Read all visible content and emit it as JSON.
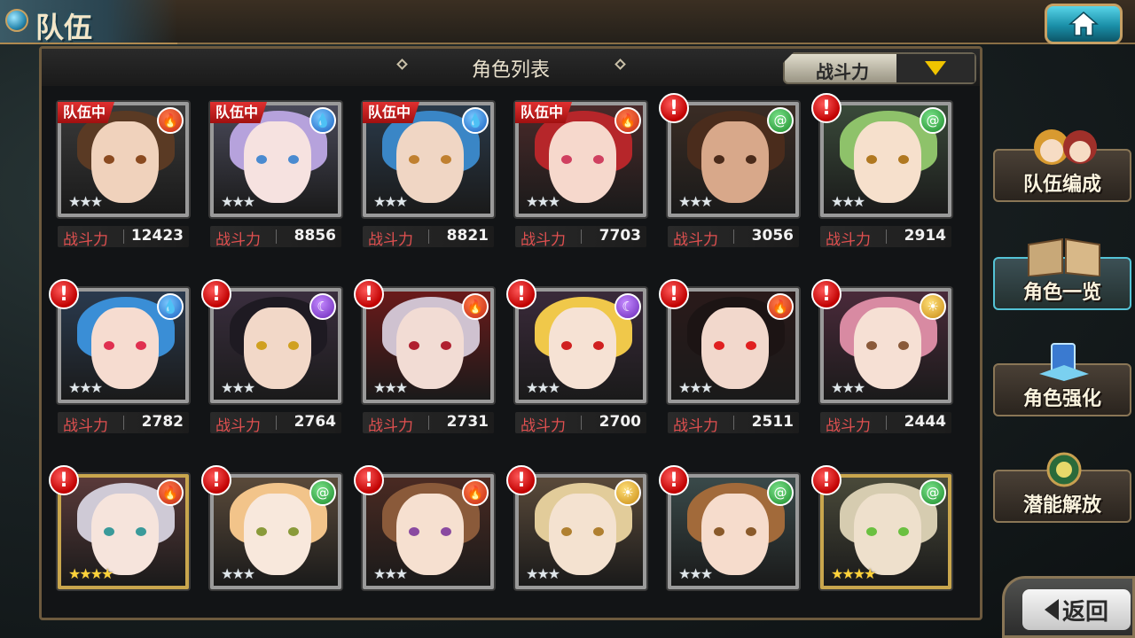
{
  "header": {
    "title": "队伍",
    "home_icon": "home-icon"
  },
  "panel": {
    "title": "角色列表",
    "sort_label": "战斗力",
    "power_label": "战斗力"
  },
  "side_menu": [
    {
      "label": "队伍编成",
      "active": false
    },
    {
      "label": "角色一览",
      "active": true
    },
    {
      "label": "角色强化",
      "active": false
    },
    {
      "label": "潜能解放",
      "active": false
    }
  ],
  "back_label": "返回",
  "colors": {
    "fire": "#d83a1a",
    "water": "#2a78d8",
    "wind": "#2aa23a",
    "dark": "#8a3ad8",
    "light": "#e0a020",
    "alert": "#d40000",
    "team_badge": "#c81e1e"
  },
  "team_badge_label": "队伍中",
  "characters": [
    {
      "badge": "队伍中",
      "element": "fire",
      "stars": "★★★",
      "gold": false,
      "power": "12423",
      "hair": "#5a3a24",
      "skin": "#f0d2bc",
      "bg": "#3a3a3a",
      "eye": "#8a4a20"
    },
    {
      "badge": "队伍中",
      "element": "water",
      "stars": "★★★",
      "gold": false,
      "power": "8856",
      "hair": "#b6a2dc",
      "skin": "#f6e2e0",
      "bg": "#4a4a5a",
      "eye": "#4a8ad0"
    },
    {
      "badge": "队伍中",
      "element": "water",
      "stars": "★★★",
      "gold": false,
      "power": "8821",
      "hair": "#3a86c6",
      "skin": "#f0d6c4",
      "bg": "#2a3a4a",
      "eye": "#c08030"
    },
    {
      "badge": "队伍中",
      "element": "fire",
      "stars": "★★★",
      "gold": false,
      "power": "7703",
      "hair": "#b6262a",
      "skin": "#f6d8cc",
      "bg": "#4a2a2a",
      "eye": "#d04060"
    },
    {
      "badge": "",
      "alert": "!",
      "element": "wind",
      "stars": "★★★",
      "gold": false,
      "power": "3056",
      "hair": "#4a2c1c",
      "skin": "#d8a88a",
      "bg": "#3a2c24",
      "eye": "#4a2a1a"
    },
    {
      "badge": "",
      "alert": "!",
      "element": "wind",
      "stars": "★★★",
      "gold": false,
      "power": "2914",
      "hair": "#8ec26a",
      "skin": "#f6e0cc",
      "bg": "#3a4a3a",
      "eye": "#b07820"
    },
    {
      "badge": "",
      "alert": "!",
      "element": "water",
      "stars": "★★★",
      "gold": false,
      "power": "2782",
      "hair": "#3a8ed6",
      "skin": "#f6dcd0",
      "bg": "#2a3a4e",
      "eye": "#e03050"
    },
    {
      "badge": "",
      "alert": "!",
      "element": "dark",
      "stars": "★★★",
      "gold": false,
      "power": "2764",
      "hair": "#1e1a22",
      "skin": "#f2d8c8",
      "bg": "#3a2e3e",
      "eye": "#d0a020"
    },
    {
      "badge": "",
      "alert": "!",
      "element": "fire",
      "stars": "★★★",
      "gold": false,
      "power": "2731",
      "hair": "#cfc2d0",
      "skin": "#f2dcd4",
      "bg": "#6a1a1a",
      "eye": "#b02030"
    },
    {
      "badge": "",
      "alert": "!",
      "element": "dark",
      "stars": "★★★",
      "gold": false,
      "power": "2700",
      "hair": "#f0c84a",
      "skin": "#f6e2d4",
      "bg": "#3a2a3a",
      "eye": "#d02020"
    },
    {
      "badge": "",
      "alert": "!",
      "element": "fire",
      "stars": "★★★",
      "gold": false,
      "power": "2511",
      "hair": "#1c1414",
      "skin": "#f2d8cc",
      "bg": "#2a1a1a",
      "eye": "#e02020"
    },
    {
      "badge": "",
      "alert": "!",
      "element": "light",
      "stars": "★★★",
      "gold": false,
      "power": "2444",
      "hair": "#d88aa2",
      "skin": "#f6e0d4",
      "bg": "#4a2a3a",
      "eye": "#8a5a3a"
    },
    {
      "badge": "",
      "alert": "!",
      "element": "fire",
      "stars": "★★★★",
      "gold": true,
      "power": "",
      "hair": "#cfcad6",
      "skin": "#f6e4dc",
      "bg": "#5a3a3a",
      "eye": "#3a9a9a"
    },
    {
      "badge": "",
      "alert": "!",
      "element": "wind",
      "stars": "★★★",
      "gold": false,
      "power": "",
      "hair": "#f2c48a",
      "skin": "#f8e8dc",
      "bg": "#5a4a3a",
      "eye": "#8a9a3a"
    },
    {
      "badge": "",
      "alert": "!",
      "element": "fire",
      "stars": "★★★",
      "gold": false,
      "power": "",
      "hair": "#8a5a3a",
      "skin": "#f6e0d0",
      "bg": "#4a2a22",
      "eye": "#8a4aa0"
    },
    {
      "badge": "",
      "alert": "!",
      "element": "light",
      "stars": "★★★",
      "gold": false,
      "power": "",
      "hair": "#e2cc9a",
      "skin": "#f4e2d0",
      "bg": "#5a4a3a",
      "eye": "#b08030"
    },
    {
      "badge": "",
      "alert": "!",
      "element": "wind",
      "stars": "★★★",
      "gold": false,
      "power": "",
      "hair": "#a26a3a",
      "skin": "#f6dccc",
      "bg": "#3a4a4a",
      "eye": "#8a5a2a"
    },
    {
      "badge": "",
      "alert": "!",
      "element": "wind",
      "stars": "★★★★",
      "gold": true,
      "power": "",
      "hair": "#d6ccb0",
      "skin": "#eee0cc",
      "bg": "#4a4a3a",
      "eye": "#6ac040"
    }
  ]
}
